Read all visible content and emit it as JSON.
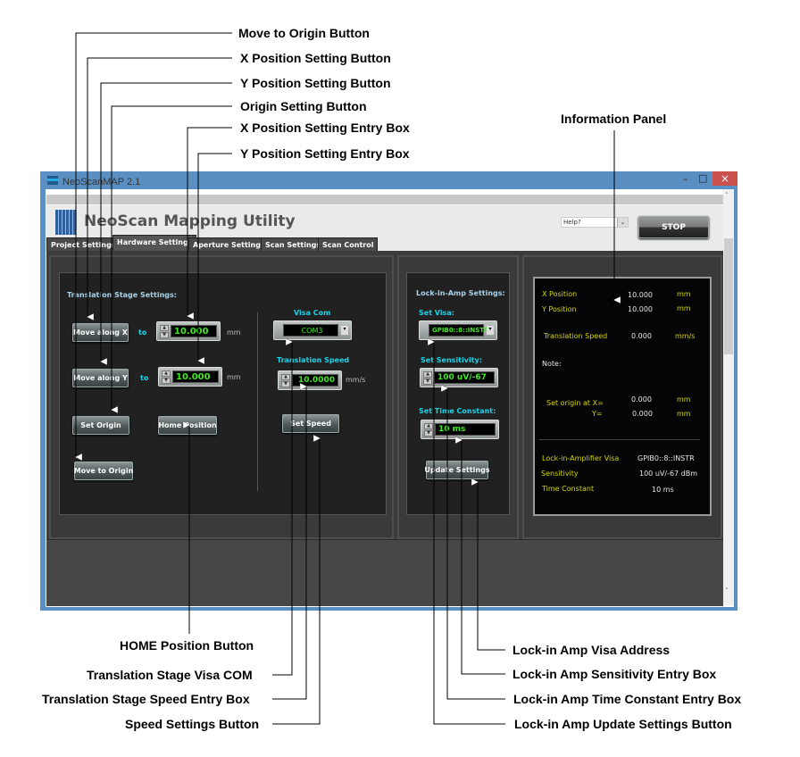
{
  "callouts": {
    "move_to_origin": "Move to Origin Button",
    "x_pos_button": "X Position Setting Button",
    "y_pos_button": "Y Position Setting Button",
    "origin_button": "Origin Setting Button",
    "x_entry": "X Position Setting Entry Box",
    "y_entry": "Y Position Setting Entry Box",
    "info_panel": "Information Panel",
    "home_button": "HOME Position Button",
    "visa_com": "Translation Stage Visa COM",
    "speed_entry": "Translation Stage Speed Entry Box",
    "speed_button": "Speed Settings Button",
    "lia_visa": "Lock-in Amp Visa Address",
    "lia_sens": "Lock-in Amp Sensitivity Entry Box",
    "lia_tc": "Lock-in Amp Time Constant Entry Box",
    "lia_update": "Lock-in Amp Update Settings Button"
  },
  "window": {
    "title": "NeoScanMAP 2.1",
    "minimize": "–",
    "maximize": "□",
    "close": "×",
    "app_title": "NeoScan Mapping Utility",
    "help_value": "Help?",
    "stop_label": "STOP"
  },
  "tabs": [
    {
      "label": "Project Settings"
    },
    {
      "label": "Hardware Settings",
      "selected": true
    },
    {
      "label": "Aperture Settings"
    },
    {
      "label": "Scan Settings"
    },
    {
      "label": "Scan Control"
    }
  ],
  "stage": {
    "heading": "Translation Stage  Settings:",
    "move_x": "Move along X",
    "move_y": "Move along Y",
    "to": "to",
    "x_value": "10.000",
    "y_value": "10.000",
    "unit": "mm",
    "set_origin": "Set Origin",
    "home": "Home Position",
    "move_origin": "Move to Origin",
    "visa_label": "Visa Com",
    "visa_value": "COM3",
    "speed_label": "Translation Speed",
    "speed_value": "10.0000",
    "speed_unit": "mm/s",
    "set_speed": "Set Speed"
  },
  "lockin": {
    "heading": "Lock-in-Amp Settings:",
    "visa_label": "Set Visa:",
    "visa_value": "GPIB0::8::INSTR",
    "sens_label": "Set Sensitivity:",
    "sens_value": "100 uV/-67",
    "tc_label": "Set Time Constant:",
    "tc_value": "10 ms",
    "update": "Update Settings"
  },
  "info": {
    "x_label": "X Position",
    "x_value": "10.000",
    "x_unit": "mm",
    "y_label": "Y Position",
    "y_value": "10.000",
    "y_unit": "mm",
    "speed_label": "Translation Speed",
    "speed_value": "0.000",
    "speed_unit": "mm/s",
    "note": "Note:",
    "origin_label": "Set origin at  X=",
    "origin_y_label": "Y=",
    "origin_x": "0.000",
    "origin_y": "0.000",
    "origin_unit": "mm",
    "lia_visa_label": "Lock-in-Amplifier Visa",
    "lia_visa": "GPIB0::8::INSTR",
    "sens_label": "Sensitivity",
    "sens": "100 uV/-67 dBm",
    "tc_label": "Time Constant",
    "tc": "10 ms"
  },
  "colors": {
    "title_bar": "#5a8fc2",
    "close": "#c9524f",
    "field_text": "#3dea1e",
    "label_cyan": "#19d3e8",
    "info_yellow": "#d6d600"
  }
}
